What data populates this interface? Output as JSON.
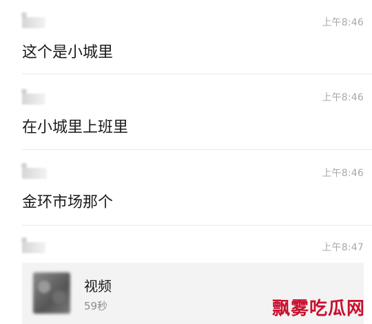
{
  "messages": [
    {
      "time": "上午8:46",
      "text": "这个是小城里"
    },
    {
      "time": "上午8:46",
      "text": "在小城里上班里"
    },
    {
      "time": "上午8:46",
      "text": "金环市场那个"
    },
    {
      "time": "上午8:47"
    }
  ],
  "video_message": {
    "title": "视频",
    "duration": "59秒"
  },
  "watermark": "飘雾吃瓜网",
  "colors": {
    "text": "#1a1a1a",
    "timestamp": "#a8a8a8",
    "divider": "#e8e8e8",
    "card_background": "#f3f3f3",
    "watermark": "#c8102e"
  }
}
